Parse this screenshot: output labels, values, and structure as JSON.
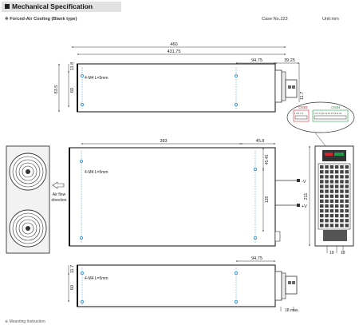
{
  "header": {
    "title": "Mechanical Specification",
    "subtitle": "Forced-Air Cooling (Blank type)",
    "subtitle_marker": "※",
    "case_no": "Case No.223",
    "unit": "Unit:mm"
  },
  "top_view": {
    "total_length": "460",
    "inner_length": "431.75",
    "right_offset_a": "94.75",
    "right_offset_b": "39.25",
    "edge_a": "11.8",
    "height_inner": "60",
    "height_total": "83.5",
    "terminal_depth": "11.7",
    "hole_note": "4-M4 L=5mm"
  },
  "side_view": {
    "length": "383",
    "right_offset": "45.8",
    "top_dim": "45.45",
    "mid_dim": "128",
    "total_height": "211",
    "hole_note": "4-M4 L=5mm",
    "terminal_minus": "-V",
    "terminal_plus": "+V",
    "airflow": [
      "Air flow",
      "direction"
    ]
  },
  "connector_callout": {
    "cn83_label": "CN83",
    "cn83_pins": "1 3 5 7 9",
    "cn84_label": "CN84",
    "cn84_pins": "1 3 5 7 9 11 13 15 17 19 21 23"
  },
  "end_view": {
    "dim_a": "19",
    "dim_b": "13"
  },
  "bottom_view": {
    "edge": "11.7",
    "right_offset": "94.75",
    "height": "60",
    "hole_note": "4-M4 L=5mm",
    "max_note": "18 max."
  },
  "footer": {
    "mounting": "※ Mounting Instruction"
  },
  "colors": {
    "hole": "#2a8fd4",
    "cn83": "#d4262e",
    "cn84": "#1f9e4a",
    "header_bg": "#e2e2e2"
  }
}
